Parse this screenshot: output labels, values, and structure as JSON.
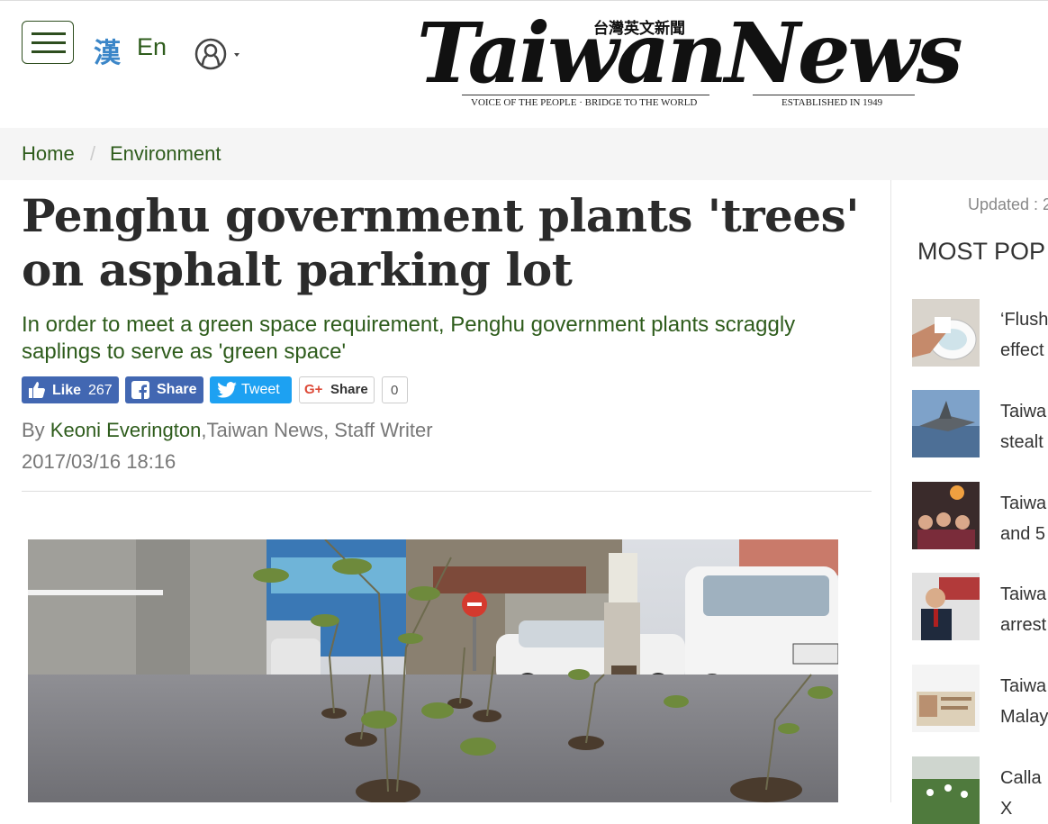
{
  "header": {
    "lang_zh": "漢",
    "lang_en": "En",
    "logo_text": "TaiwanNews",
    "logo_cjk": "台灣英文新聞",
    "logo_tagline_left": "VOICE OF THE PEOPLE · BRIDGE TO THE WORLD",
    "logo_tagline_right": "ESTABLISHED IN 1949"
  },
  "breadcrumb": {
    "home": "Home",
    "separator": "/",
    "section": "Environment"
  },
  "article": {
    "title": "Penghu government plants 'trees' on asphalt parking lot",
    "subtitle": "In order to meet a green space requirement, Penghu government plants scraggly saplings to serve as 'green space'",
    "byline_prefix": "By ",
    "author": "Keoni Everington",
    "byline_suffix": ",Taiwan News, Staff Writer",
    "date": "2017/03/16 18:16"
  },
  "social": {
    "like_label": "Like",
    "like_count": "267",
    "fb_share_label": "Share",
    "tweet_label": "Tweet",
    "gplus_share_label": "Share",
    "gplus_count": "0"
  },
  "sidebar": {
    "updated": "Updated : 2",
    "most_popular_title": "MOST POP",
    "items": [
      {
        "line1": "‘Flush",
        "line2": "effect"
      },
      {
        "line1": "Taiwa",
        "line2": "stealt"
      },
      {
        "line1": "Taiwa",
        "line2": "and 5"
      },
      {
        "line1": "Taiwa",
        "line2": "arrest"
      },
      {
        "line1": "Taiwa",
        "line2": "Malay"
      },
      {
        "line1": "Calla",
        "line2": "X"
      }
    ]
  },
  "colors": {
    "accent_green": "#2e5c1c",
    "facebook": "#4267b2",
    "twitter": "#1da1f2",
    "lang_blue": "#3b86c8"
  }
}
